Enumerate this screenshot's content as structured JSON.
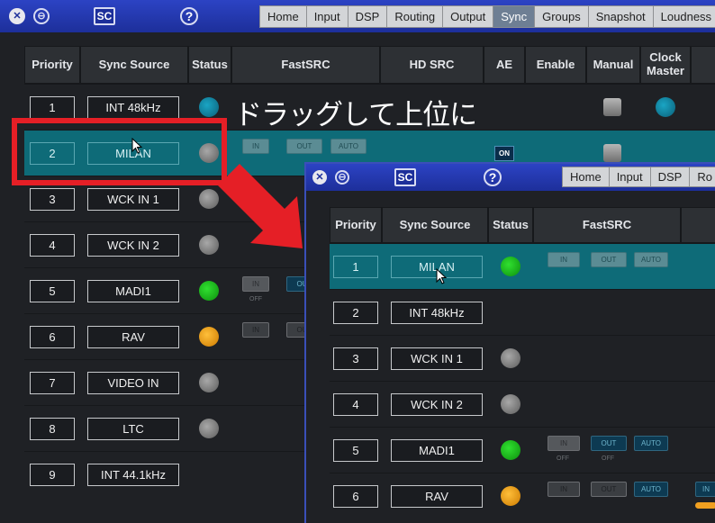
{
  "tabs": [
    "Home",
    "Input",
    "DSP",
    "Routing",
    "Output",
    "Sync",
    "Groups",
    "Snapshot",
    "Loudness"
  ],
  "active_tab": "Sync",
  "titlebar": {
    "sc_label": "SC",
    "close_glyph": "✕",
    "min_glyph": "⊖",
    "help_glyph": "?"
  },
  "headers": {
    "priority": "Priority",
    "sync_source": "Sync Source",
    "status": "Status",
    "fastsrc": "FastSRC",
    "hd_src": "HD SRC",
    "ae": "AE",
    "enable": "Enable",
    "manual": "Manual",
    "clock_master": "Clock Master"
  },
  "back_rows": [
    {
      "priority": "1",
      "source": "INT 48kHz",
      "status": "teal"
    },
    {
      "priority": "2",
      "source": "MILAN",
      "status": "grey",
      "selected": true
    },
    {
      "priority": "3",
      "source": "WCK IN 1",
      "status": "grey"
    },
    {
      "priority": "4",
      "source": "WCK IN 2",
      "status": "grey"
    },
    {
      "priority": "5",
      "source": "MADI1",
      "status": "green"
    },
    {
      "priority": "6",
      "source": "RAV",
      "status": "orange"
    },
    {
      "priority": "7",
      "source": "VIDEO IN",
      "status": "grey"
    },
    {
      "priority": "8",
      "source": "LTC",
      "status": "grey"
    },
    {
      "priority": "9",
      "source": "INT 44.1kHz",
      "status": "none"
    }
  ],
  "front_tabs": [
    "Home",
    "Input",
    "DSP",
    "Ro"
  ],
  "front_rows": [
    {
      "priority": "1",
      "source": "MILAN",
      "status": "green",
      "selected": true
    },
    {
      "priority": "2",
      "source": "INT 48kHz",
      "status": "none"
    },
    {
      "priority": "3",
      "source": "WCK IN 1",
      "status": "grey"
    },
    {
      "priority": "4",
      "source": "WCK IN 2",
      "status": "grey"
    },
    {
      "priority": "5",
      "source": "MADI1",
      "status": "green"
    },
    {
      "priority": "6",
      "source": "RAV",
      "status": "orange"
    }
  ],
  "fastsrc_buttons": {
    "in": "IN",
    "out": "OUT",
    "auto": "AUTO",
    "off": "OFF"
  },
  "ae_on": "ON",
  "annotation": "ドラッグして上位に",
  "colors": {
    "title_blue": "#2c43c4",
    "selected_row": "#0e6b78",
    "annotation_red": "#e51f26"
  }
}
